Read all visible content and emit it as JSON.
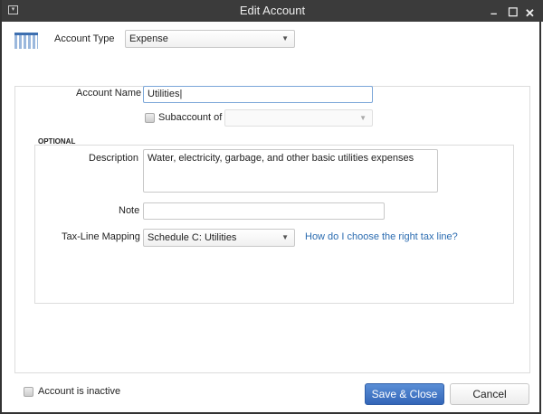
{
  "window": {
    "title": "Edit Account"
  },
  "account_type": {
    "label": "Account Type",
    "value": "Expense"
  },
  "account_name": {
    "label": "Account Name",
    "value": "Utilities"
  },
  "subaccount": {
    "label": "Subaccount of",
    "checked": false,
    "value": ""
  },
  "optional": {
    "heading": "OPTIONAL",
    "description": {
      "label": "Description",
      "value": "Water, electricity, garbage, and other basic utilities expenses"
    },
    "note": {
      "label": "Note",
      "value": ""
    },
    "tax_line": {
      "label": "Tax-Line Mapping",
      "value": "Schedule C: Utilities",
      "help_link": "How do I choose the right tax line?"
    }
  },
  "inactive": {
    "label": "Account is inactive",
    "checked": false
  },
  "buttons": {
    "save": "Save & Close",
    "cancel": "Cancel"
  },
  "colors": {
    "title_bar": "#3b3b3b",
    "primary": "#3d73c4",
    "link": "#2a6bb0"
  }
}
